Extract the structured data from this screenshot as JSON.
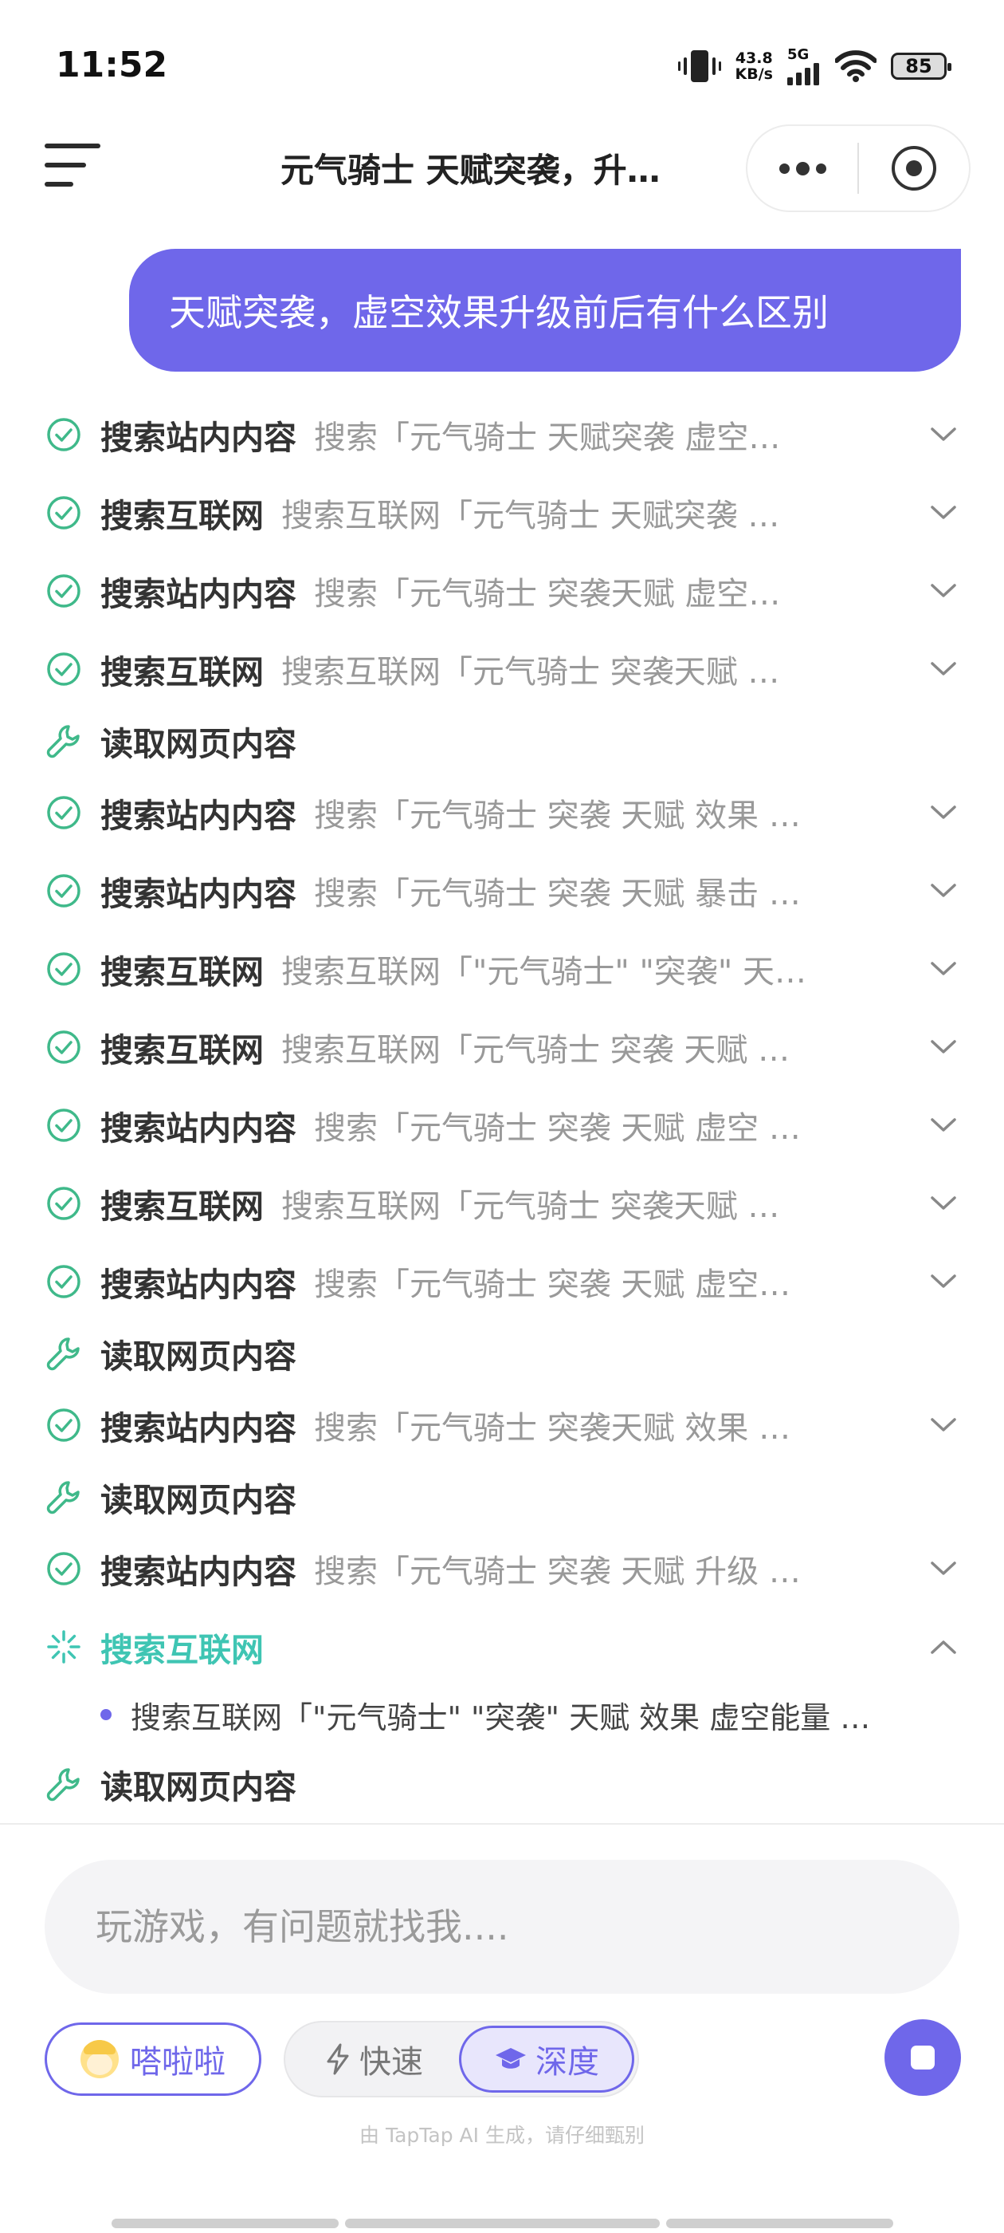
{
  "status_bar": {
    "time": "11:52",
    "speed_value": "43.8",
    "speed_unit": "KB/s",
    "network": "5G",
    "battery": "85"
  },
  "header": {
    "title": "元气骑士 天赋突袭，升…"
  },
  "chat": {
    "user_message": "天赋突袭，虚空效果升级前后有什么区别"
  },
  "steps": [
    {
      "type": "done",
      "label": "搜索站内内容",
      "query": "搜索「元气骑士 天赋突袭 虚空…",
      "expandable": true
    },
    {
      "type": "done",
      "label": "搜索互联网",
      "query": "搜索互联网「元气骑士 天赋突袭 …",
      "expandable": true
    },
    {
      "type": "done",
      "label": "搜索站内内容",
      "query": "搜索「元气骑士 突袭天赋 虚空…",
      "expandable": true
    },
    {
      "type": "done",
      "label": "搜索互联网",
      "query": "搜索互联网「元气骑士 突袭天赋 …",
      "expandable": true
    },
    {
      "type": "tool",
      "label": "读取网页内容",
      "query": "",
      "expandable": false
    },
    {
      "type": "done",
      "label": "搜索站内内容",
      "query": "搜索「元气骑士 突袭 天赋 效果 …",
      "expandable": true
    },
    {
      "type": "done",
      "label": "搜索站内内容",
      "query": "搜索「元气骑士 突袭 天赋 暴击 …",
      "expandable": true
    },
    {
      "type": "done",
      "label": "搜索互联网",
      "query": "搜索互联网「\"元气骑士\" \"突袭\" 天…",
      "expandable": true
    },
    {
      "type": "done",
      "label": "搜索互联网",
      "query": "搜索互联网「元气骑士 突袭 天赋 …",
      "expandable": true
    },
    {
      "type": "done",
      "label": "搜索站内内容",
      "query": "搜索「元气骑士 突袭 天赋 虚空 …",
      "expandable": true
    },
    {
      "type": "done",
      "label": "搜索互联网",
      "query": "搜索互联网「元气骑士 突袭天赋 …",
      "expandable": true
    },
    {
      "type": "done",
      "label": "搜索站内内容",
      "query": "搜索「元气骑士 突袭 天赋 虚空…",
      "expandable": true
    },
    {
      "type": "tool",
      "label": "读取网页内容",
      "query": "",
      "expandable": false
    },
    {
      "type": "done",
      "label": "搜索站内内容",
      "query": "搜索「元气骑士 突袭天赋 效果 …",
      "expandable": true
    },
    {
      "type": "tool",
      "label": "读取网页内容",
      "query": "",
      "expandable": false
    },
    {
      "type": "done",
      "label": "搜索站内内容",
      "query": "搜索「元气骑士 突袭 天赋 升级 …",
      "expandable": true
    },
    {
      "type": "loading",
      "label": "搜索互联网",
      "query": "",
      "expandable": true,
      "expanded": true
    },
    {
      "type": "sub",
      "label": "",
      "query": "搜索互联网「\"元气骑士\" \"突袭\" 天赋 效果 虚空能量 …"
    },
    {
      "type": "tool",
      "label": "读取网页内容",
      "query": "",
      "expandable": false
    }
  ],
  "input": {
    "placeholder": "玩游戏，有问题就找我...."
  },
  "controls": {
    "agent_name": "嗒啦啦",
    "mode_fast": "快速",
    "mode_deep": "深度",
    "selected_mode": "深度"
  },
  "footer": {
    "disclaimer": "由 TapTap AI 生成，请仔细甄别"
  },
  "colors": {
    "accent": "#6f67ea",
    "success": "#3fb98a",
    "loading": "#3fc5b3",
    "tool": "#3fb98a"
  }
}
